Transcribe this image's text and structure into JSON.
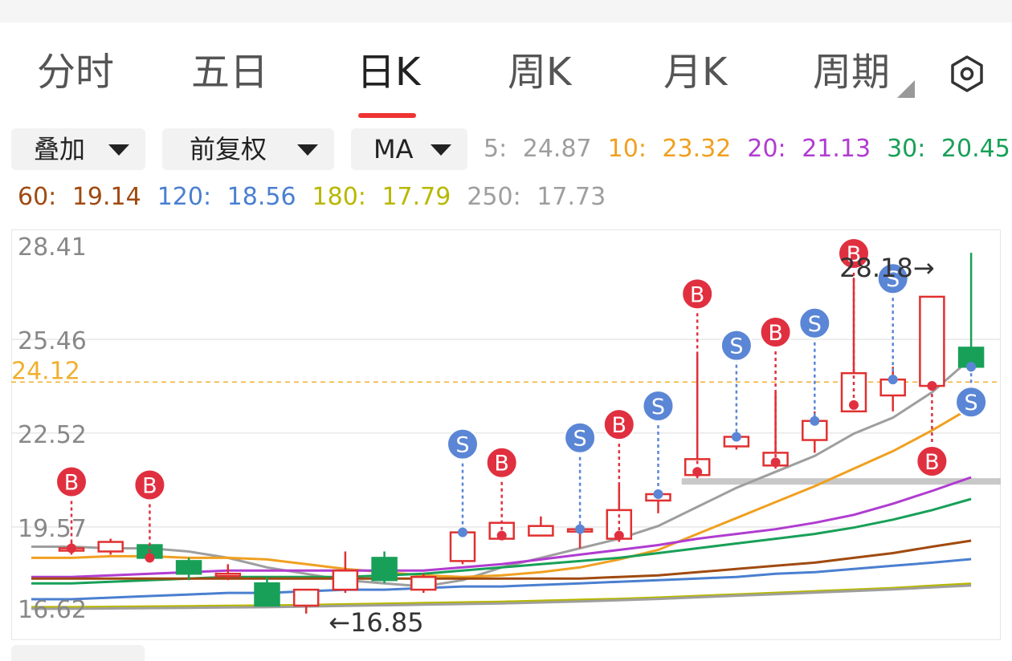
{
  "tabs": [
    {
      "label": "分时",
      "active": false
    },
    {
      "label": "五日",
      "active": false
    },
    {
      "label": "日K",
      "active": true
    },
    {
      "label": "周K",
      "active": false
    },
    {
      "label": "月K",
      "active": false
    },
    {
      "label": "周期",
      "active": false
    }
  ],
  "settings_icon": "hexagon-gear-icon",
  "toolbar": {
    "overlay_label": "叠加",
    "adjust_label": "前复权",
    "indicator_label": "MA"
  },
  "ma": [
    {
      "label": "5:",
      "value": "24.87",
      "color": "#9e9e9e"
    },
    {
      "label": "10:",
      "value": "23.32",
      "color": "#f0a020"
    },
    {
      "label": "20:",
      "value": "21.13",
      "color": "#b03cd0"
    },
    {
      "label": "30:",
      "value": "20.45",
      "color": "#18a058"
    },
    {
      "label": "60:",
      "value": "19.14",
      "color": "#a04a10"
    },
    {
      "label": "120:",
      "value": "18.56",
      "color": "#4a7fd0"
    },
    {
      "label": "180:",
      "value": "17.79",
      "color": "#b8b800"
    },
    {
      "label": "250:",
      "value": "17.73",
      "color": "#9e9e9e"
    }
  ],
  "chart_data": {
    "type": "candlestick",
    "y_ticks": [
      "28.41",
      "25.46",
      "22.52",
      "19.57",
      "16.62"
    ],
    "ylim": [
      16.62,
      28.41
    ],
    "current_price": "24.12",
    "max_label": "28.18→",
    "min_label": "←16.85",
    "colors": {
      "up": "#e03030",
      "down": "#18a058",
      "buy": "#e03040",
      "sell": "#5b86d6",
      "price_line": "#f0b030"
    },
    "candles": [
      {
        "o": 18.9,
        "c": 18.9,
        "h": 19.1,
        "l": 18.7
      },
      {
        "o": 18.8,
        "c": 19.1,
        "h": 19.2,
        "l": 18.7
      },
      {
        "o": 19.0,
        "c": 18.6,
        "h": 19.0,
        "l": 18.5
      },
      {
        "o": 18.5,
        "c": 18.1,
        "h": 18.6,
        "l": 17.9
      },
      {
        "o": 18.1,
        "c": 18.1,
        "h": 18.4,
        "l": 17.9
      },
      {
        "o": 17.8,
        "c": 17.1,
        "h": 18.0,
        "l": 17.1
      },
      {
        "o": 17.1,
        "c": 17.6,
        "h": 17.6,
        "l": 16.85
      },
      {
        "o": 17.6,
        "c": 18.2,
        "h": 18.8,
        "l": 17.5
      },
      {
        "o": 18.6,
        "c": 17.9,
        "h": 18.8,
        "l": 17.8
      },
      {
        "o": 17.6,
        "c": 18.0,
        "h": 18.1,
        "l": 17.5
      },
      {
        "o": 18.5,
        "c": 19.4,
        "h": 19.4,
        "l": 18.4
      },
      {
        "o": 19.2,
        "c": 19.7,
        "h": 19.7,
        "l": 19.2
      },
      {
        "o": 19.3,
        "c": 19.6,
        "h": 19.9,
        "l": 19.3
      },
      {
        "o": 19.5,
        "c": 19.5,
        "h": 19.6,
        "l": 18.9
      },
      {
        "o": 19.2,
        "c": 20.1,
        "h": 20.9,
        "l": 19.1
      },
      {
        "o": 20.4,
        "c": 20.6,
        "h": 20.6,
        "l": 20.0
      },
      {
        "o": 21.2,
        "c": 21.7,
        "h": 25.0,
        "l": 21.1
      },
      {
        "o": 22.1,
        "c": 22.4,
        "h": 22.5,
        "l": 22.0
      },
      {
        "o": 21.5,
        "c": 21.9,
        "h": 23.8,
        "l": 21.4
      },
      {
        "o": 22.3,
        "c": 22.9,
        "h": 23.2,
        "l": 21.9
      },
      {
        "o": 23.2,
        "c": 24.4,
        "h": 27.4,
        "l": 23.2
      },
      {
        "o": 23.7,
        "c": 24.2,
        "h": 24.6,
        "l": 23.2
      },
      {
        "o": 24.0,
        "c": 26.8,
        "h": 26.8,
        "l": 23.9
      },
      {
        "o": 25.2,
        "c": 24.6,
        "h": 28.18,
        "l": 24.5
      }
    ],
    "signals": [
      {
        "i": 0,
        "t": "B",
        "price": 18.9
      },
      {
        "i": 2,
        "t": "B",
        "price": 18.6
      },
      {
        "i": 10,
        "t": "S",
        "price": 19.4
      },
      {
        "i": 11,
        "t": "B",
        "price": 19.3
      },
      {
        "i": 13,
        "t": "S",
        "price": 19.5
      },
      {
        "i": 14,
        "t": "B",
        "price": 19.3
      },
      {
        "i": 15,
        "t": "S",
        "price": 20.6
      },
      {
        "i": 16,
        "t": "B",
        "price": 21.3
      },
      {
        "i": 17,
        "t": "S",
        "price": 22.4
      },
      {
        "i": 18,
        "t": "B",
        "price": 21.6
      },
      {
        "i": 19,
        "t": "S",
        "price": 22.9
      },
      {
        "i": 20,
        "t": "B",
        "price": 23.4
      },
      {
        "i": 21,
        "t": "S",
        "price": 24.2
      },
      {
        "i": 22,
        "t": "B",
        "price": 24.0
      },
      {
        "i": 23,
        "t": "S",
        "price": 24.6
      }
    ],
    "ma_lines": [
      {
        "name": "5",
        "values": [
          18.95,
          18.9,
          18.9,
          18.8,
          18.6,
          18.3,
          18.1,
          17.9,
          17.8,
          17.7,
          17.9,
          18.3,
          18.6,
          18.9,
          19.2,
          19.6,
          20.2,
          20.8,
          21.3,
          21.8,
          22.5,
          23.0,
          23.8,
          24.87
        ]
      },
      {
        "name": "10",
        "values": [
          18.6,
          18.65,
          18.65,
          18.6,
          18.6,
          18.55,
          18.4,
          18.25,
          18.15,
          18.05,
          18.0,
          18.05,
          18.15,
          18.3,
          18.55,
          18.85,
          19.35,
          19.85,
          20.35,
          20.85,
          21.4,
          21.95,
          22.6,
          23.32
        ]
      },
      {
        "name": "20",
        "values": [
          18.0,
          18.05,
          18.1,
          18.15,
          18.2,
          18.2,
          18.2,
          18.2,
          18.2,
          18.2,
          18.3,
          18.4,
          18.55,
          18.7,
          18.85,
          19.0,
          19.2,
          19.35,
          19.5,
          19.7,
          19.95,
          20.3,
          20.7,
          21.13
        ]
      },
      {
        "name": "30",
        "values": [
          17.8,
          17.85,
          17.9,
          17.95,
          18.0,
          18.0,
          18.0,
          18.0,
          18.05,
          18.1,
          18.2,
          18.3,
          18.4,
          18.5,
          18.6,
          18.75,
          18.9,
          19.05,
          19.2,
          19.35,
          19.55,
          19.8,
          20.1,
          20.45
        ]
      },
      {
        "name": "60",
        "values": [
          17.95,
          17.95,
          17.95,
          17.95,
          17.95,
          17.95,
          17.95,
          17.95,
          17.95,
          17.95,
          17.95,
          17.95,
          17.95,
          17.95,
          18.0,
          18.05,
          18.15,
          18.25,
          18.35,
          18.45,
          18.6,
          18.75,
          18.95,
          19.14
        ]
      },
      {
        "name": "120",
        "values": [
          17.3,
          17.35,
          17.4,
          17.45,
          17.5,
          17.5,
          17.55,
          17.6,
          17.6,
          17.65,
          17.7,
          17.7,
          17.75,
          17.8,
          17.85,
          17.9,
          17.95,
          18.0,
          18.1,
          18.15,
          18.25,
          18.35,
          18.45,
          18.56
        ]
      },
      {
        "name": "180",
        "values": [
          17.05,
          17.06,
          17.07,
          17.08,
          17.09,
          17.1,
          17.12,
          17.14,
          17.16,
          17.18,
          17.2,
          17.22,
          17.25,
          17.28,
          17.31,
          17.35,
          17.4,
          17.45,
          17.5,
          17.55,
          17.6,
          17.65,
          17.72,
          17.79
        ]
      },
      {
        "name": "250",
        "values": [
          17.0,
          17.01,
          17.02,
          17.03,
          17.04,
          17.05,
          17.07,
          17.09,
          17.11,
          17.13,
          17.15,
          17.17,
          17.2,
          17.23,
          17.27,
          17.31,
          17.36,
          17.41,
          17.46,
          17.51,
          17.56,
          17.61,
          17.67,
          17.73
        ]
      }
    ],
    "ma_colors": [
      "#9e9e9e",
      "#f0a020",
      "#b03cd0",
      "#18a058",
      "#a04a10",
      "#4a7fd0",
      "#b8b800",
      "#9e9e9e"
    ]
  }
}
